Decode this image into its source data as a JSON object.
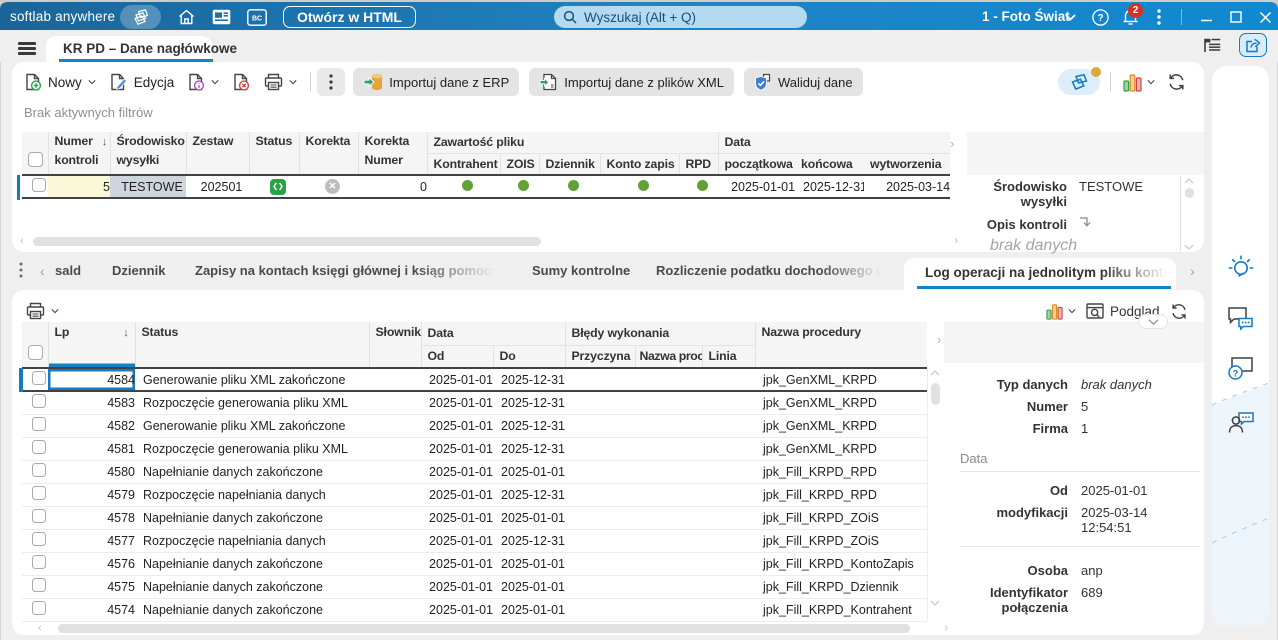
{
  "titlebar": {
    "brand": "softlab anywhere",
    "open_html_label": "Otwórz w HTML",
    "search_placeholder": "Wyszukaj (Alt + Q)",
    "company": "1 - Foto Świat",
    "notifications_count": "2"
  },
  "workspace_tab": {
    "label": "KR PD – Dane nagłówkowe"
  },
  "toolbar": {
    "new": "Nowy",
    "edit": "Edycja",
    "import_erp": "Importuj dane z ERP",
    "import_xml": "Importuj dane z plików XML",
    "validate": "Waliduj dane"
  },
  "filters_status": "Brak aktywnych filtrów",
  "header_grid": {
    "columns": {
      "numer_l1": "Numer",
      "numer_l2": "kontroli",
      "srodowisko_l1": "Środowisko",
      "srodowisko_l2": "wysyłki",
      "zestaw": "Zestaw",
      "status": "Status",
      "korekta": "Korekta",
      "korekta_numer_l1": "Korekta",
      "korekta_numer_l2": "Numer",
      "group_zawartosc": "Zawartość pliku",
      "kontrahent": "Kontrahent",
      "zois": "ZOIS",
      "dziennik": "Dziennik",
      "konto_zapis": "Konto zapis",
      "rpd": "RPD",
      "group_data": "Data",
      "poczatkowa": "początkowa",
      "koncowa": "końcowa",
      "wytworzenia": "wytworzenia"
    },
    "row": {
      "numer": "5",
      "srodowisko": "TESTOWE",
      "zestaw": "202501",
      "korekta_numer": "0",
      "data_poczatkowa": "2025-01-01",
      "data_koncowa": "2025-12-31",
      "data_wytworzenia": "2025-03-14"
    }
  },
  "header_detail_panel": {
    "srodowisko_label": "Środowisko wysyłki",
    "srodowisko_value": "TESTOWE",
    "opis_label": "Opis kontroli",
    "opis_value": "brak danych"
  },
  "section_tabs": {
    "clipped_first": "sald",
    "tab_dziennik": "Dziennik",
    "tab_zapisy": "Zapisy na kontach księgi głównej i ksiąg pomocniczych",
    "tab_sumy": "Sumy kontrolne",
    "tab_rozliczenie": "Rozliczenie podatku dochodowego (RPD)",
    "active": "Log operacji na jednolitym pliku kontrolnym"
  },
  "log_toolbar": {
    "preview": "Podgląd"
  },
  "log_grid": {
    "columns": {
      "lp": "Lp",
      "status": "Status",
      "slownik": "Słownik",
      "group_data": "Data",
      "od": "Od",
      "do": "Do",
      "group_bledy": "Błędy wykonania",
      "przyczyna": "Przyczyna",
      "nazwa_proc": "Nazwa proc",
      "linia": "Linia",
      "nazwa_procedury": "Nazwa procedury"
    },
    "rows": [
      {
        "lp": "4584",
        "status": "Generowanie pliku XML zakończone",
        "od": "2025-01-01",
        "do": "2025-12-31",
        "procedura": "jpk_GenXML_KRPD",
        "selected": true
      },
      {
        "lp": "4583",
        "status": "Rozpoczęcie generowania pliku XML",
        "od": "2025-01-01",
        "do": "2025-12-31",
        "procedura": "jpk_GenXML_KRPD"
      },
      {
        "lp": "4582",
        "status": "Generowanie pliku XML zakończone",
        "od": "2025-01-01",
        "do": "2025-12-31",
        "procedura": "jpk_GenXML_KRPD"
      },
      {
        "lp": "4581",
        "status": "Rozpoczęcie generowania pliku XML",
        "od": "2025-01-01",
        "do": "2025-12-31",
        "procedura": "jpk_GenXML_KRPD"
      },
      {
        "lp": "4580",
        "status": "Napełnianie danych zakończone",
        "od": "2025-01-01",
        "do": "2025-01-01",
        "procedura": "jpk_Fill_KRPD_RPD"
      },
      {
        "lp": "4579",
        "status": "Rozpoczęcie napełniania danych",
        "od": "2025-01-01",
        "do": "2025-12-31",
        "procedura": "jpk_Fill_KRPD_RPD"
      },
      {
        "lp": "4578",
        "status": "Napełnianie danych zakończone",
        "od": "2025-01-01",
        "do": "2025-01-01",
        "procedura": "jpk_Fill_KRPD_ZOiS"
      },
      {
        "lp": "4577",
        "status": "Rozpoczęcie napełniania danych",
        "od": "2025-01-01",
        "do": "2025-12-31",
        "procedura": "jpk_Fill_KRPD_ZOiS"
      },
      {
        "lp": "4576",
        "status": "Napełnianie danych zakończone",
        "od": "2025-01-01",
        "do": "2025-01-01",
        "procedura": "jpk_Fill_KRPD_KontoZapis"
      },
      {
        "lp": "4575",
        "status": "Napełnianie danych zakończone",
        "od": "2025-01-01",
        "do": "2025-01-01",
        "procedura": "jpk_Fill_KRPD_Dziennik"
      },
      {
        "lp": "4574",
        "status": "Napełnianie danych zakończone",
        "od": "2025-01-01",
        "do": "2025-01-01",
        "procedura": "jpk_Fill_KRPD_Kontrahent"
      }
    ]
  },
  "log_detail_panel": {
    "typ_danych_label": "Typ danych",
    "typ_danych_value": "brak danych",
    "numer_label": "Numer",
    "numer_value": "5",
    "firma_label": "Firma",
    "firma_value": "1",
    "data_section": "Data",
    "od_label": "Od",
    "od_value": "2025-01-01",
    "modyfikacji_label": "modyfikacji",
    "modyfikacji_value": "2025-03-14 12:54:51",
    "osoba_label": "Osoba",
    "osoba_value": "anp",
    "identyfikator_label": "Identyfikator połączenia",
    "identyfikator_value": "689"
  },
  "colors": {
    "accent_blue": "#1380c4",
    "selection_blue": "#1779c0",
    "green_dot": "#61a135",
    "status_green": "#27a348",
    "badge_red": "#d93025"
  }
}
